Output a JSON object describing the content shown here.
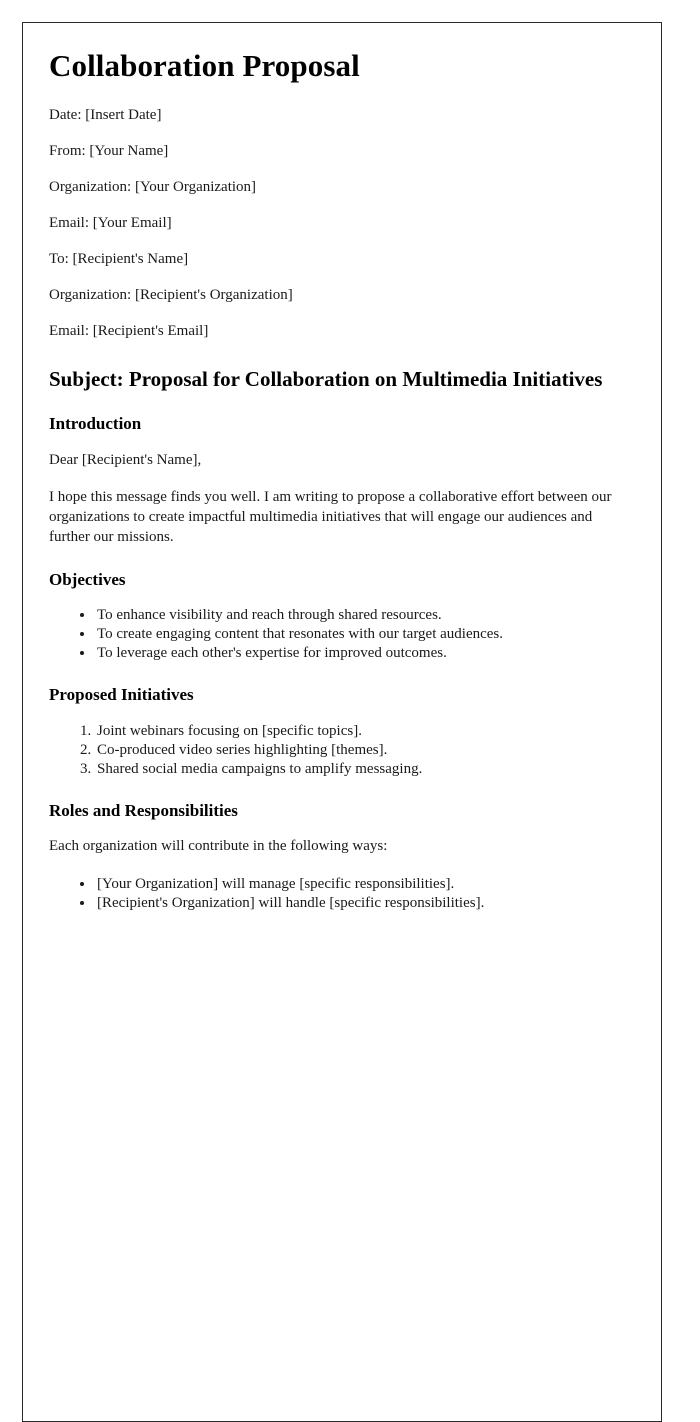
{
  "document": {
    "title": "Collaboration Proposal",
    "meta": [
      "Date: [Insert Date]",
      "From: [Your Name]",
      "Organization: [Your Organization]",
      "Email: [Your Email]",
      "To: [Recipient's Name]",
      "Organization: [Recipient's Organization]",
      "Email: [Recipient's Email]"
    ],
    "subject_heading": "Subject: Proposal for Collaboration on Multimedia Initiatives",
    "sections": {
      "introduction": {
        "heading": "Introduction",
        "salutation": "Dear [Recipient's Name],",
        "paragraph": "I hope this message finds you well. I am writing to propose a collaborative effort between our organizations to create impactful multimedia initiatives that will engage our audiences and further our missions."
      },
      "objectives": {
        "heading": "Objectives",
        "items": [
          "To enhance visibility and reach through shared resources.",
          "To create engaging content that resonates with our target audiences.",
          "To leverage each other's expertise for improved outcomes."
        ]
      },
      "proposed_initiatives": {
        "heading": "Proposed Initiatives",
        "items": [
          "Joint webinars focusing on [specific topics].",
          "Co-produced video series highlighting [themes].",
          "Shared social media campaigns to amplify messaging."
        ]
      },
      "roles": {
        "heading": "Roles and Responsibilities",
        "intro": "Each organization will contribute in the following ways:",
        "items": [
          "[Your Organization] will manage [specific responsibilities].",
          "[Recipient's Organization] will handle [specific responsibilities]."
        ]
      }
    }
  }
}
